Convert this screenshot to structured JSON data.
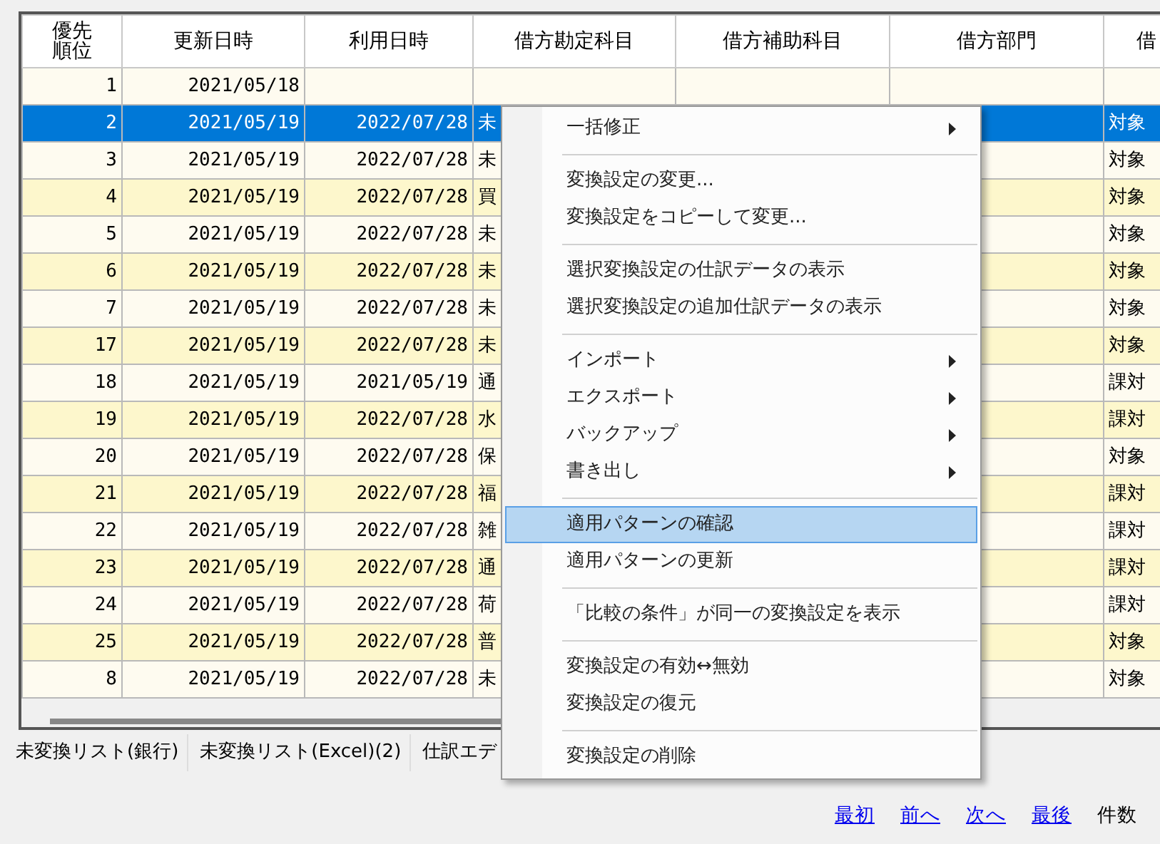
{
  "table": {
    "columns": [
      "優先順位",
      "更新日時",
      "利用日時",
      "借方勘定科目",
      "借方補助科目",
      "借方部門",
      "借"
    ],
    "rows": [
      {
        "selected": false,
        "cells": [
          "1",
          "2021/05/18",
          "",
          "",
          "",
          "",
          ""
        ]
      },
      {
        "selected": true,
        "cells": [
          "2",
          "2021/05/19",
          "2022/07/28",
          "未",
          "",
          "",
          "対象"
        ]
      },
      {
        "selected": false,
        "cells": [
          "3",
          "2021/05/19",
          "2022/07/28",
          "未",
          "",
          "",
          "対象"
        ]
      },
      {
        "selected": false,
        "cells": [
          "4",
          "2021/05/19",
          "2022/07/28",
          "買",
          "",
          "",
          "対象"
        ]
      },
      {
        "selected": false,
        "cells": [
          "5",
          "2021/05/19",
          "2022/07/28",
          "未",
          "",
          "",
          "対象"
        ]
      },
      {
        "selected": false,
        "cells": [
          "6",
          "2021/05/19",
          "2022/07/28",
          "未",
          "",
          "",
          "対象"
        ]
      },
      {
        "selected": false,
        "cells": [
          "7",
          "2021/05/19",
          "2022/07/28",
          "未",
          "",
          "",
          "対象"
        ]
      },
      {
        "selected": false,
        "cells": [
          "17",
          "2021/05/19",
          "2022/07/28",
          "未",
          "",
          "",
          "対象"
        ]
      },
      {
        "selected": false,
        "cells": [
          "18",
          "2021/05/19",
          "2021/05/19",
          "通",
          "",
          "",
          "課対"
        ]
      },
      {
        "selected": false,
        "cells": [
          "19",
          "2021/05/19",
          "2022/07/28",
          "水",
          "",
          "",
          "課対"
        ]
      },
      {
        "selected": false,
        "cells": [
          "20",
          "2021/05/19",
          "2022/07/28",
          "保",
          "",
          "",
          "対象"
        ]
      },
      {
        "selected": false,
        "cells": [
          "21",
          "2021/05/19",
          "2022/07/28",
          "福",
          "",
          "",
          "課対"
        ]
      },
      {
        "selected": false,
        "cells": [
          "22",
          "2021/05/19",
          "2022/07/28",
          "雑",
          "",
          "",
          "課対"
        ]
      },
      {
        "selected": false,
        "cells": [
          "23",
          "2021/05/19",
          "2022/07/28",
          "通",
          "",
          "",
          "課対"
        ]
      },
      {
        "selected": false,
        "cells": [
          "24",
          "2021/05/19",
          "2022/07/28",
          "荷",
          "",
          "",
          "課対"
        ]
      },
      {
        "selected": false,
        "cells": [
          "25",
          "2021/05/19",
          "2022/07/28",
          "普",
          "",
          "",
          "対象"
        ]
      },
      {
        "selected": false,
        "cells": [
          "8",
          "2021/05/19",
          "2022/07/28",
          "未",
          "",
          "",
          "対象"
        ]
      }
    ]
  },
  "tabs": [
    {
      "label": "未変換リスト(銀行)",
      "selected": false
    },
    {
      "label": "未変換リスト(Excel)(2)",
      "selected": false
    },
    {
      "label": "仕訳エデ",
      "selected": false
    }
  ],
  "pager": {
    "links": [
      "最初",
      "前へ",
      "次へ",
      "最後"
    ],
    "count_label": "件数"
  },
  "context_menu": {
    "groups": [
      [
        {
          "label": "一括修正",
          "submenu": true,
          "selected": false
        }
      ],
      [
        {
          "label": "変換設定の変更...",
          "submenu": false,
          "selected": false
        },
        {
          "label": "変換設定をコピーして変更...",
          "submenu": false,
          "selected": false
        }
      ],
      [
        {
          "label": "選択変換設定の仕訳データの表示",
          "submenu": false,
          "selected": false
        },
        {
          "label": "選択変換設定の追加仕訳データの表示",
          "submenu": false,
          "selected": false
        }
      ],
      [
        {
          "label": "インポート",
          "submenu": true,
          "selected": false
        },
        {
          "label": "エクスポート",
          "submenu": true,
          "selected": false
        },
        {
          "label": "バックアップ",
          "submenu": true,
          "selected": false
        },
        {
          "label": "書き出し",
          "submenu": true,
          "selected": false
        }
      ],
      [
        {
          "label": "適用パターンの確認",
          "submenu": false,
          "selected": true
        },
        {
          "label": "適用パターンの更新",
          "submenu": false,
          "selected": false
        }
      ],
      [
        {
          "label": "「比較の条件」が同一の変換設定を表示",
          "submenu": false,
          "selected": false
        }
      ],
      [
        {
          "label": "変換設定の有効↔無効",
          "submenu": false,
          "selected": false
        },
        {
          "label": "変換設定の復元",
          "submenu": false,
          "selected": false
        }
      ],
      [
        {
          "label": "変換設定の削除",
          "submenu": false,
          "selected": false
        }
      ]
    ]
  }
}
